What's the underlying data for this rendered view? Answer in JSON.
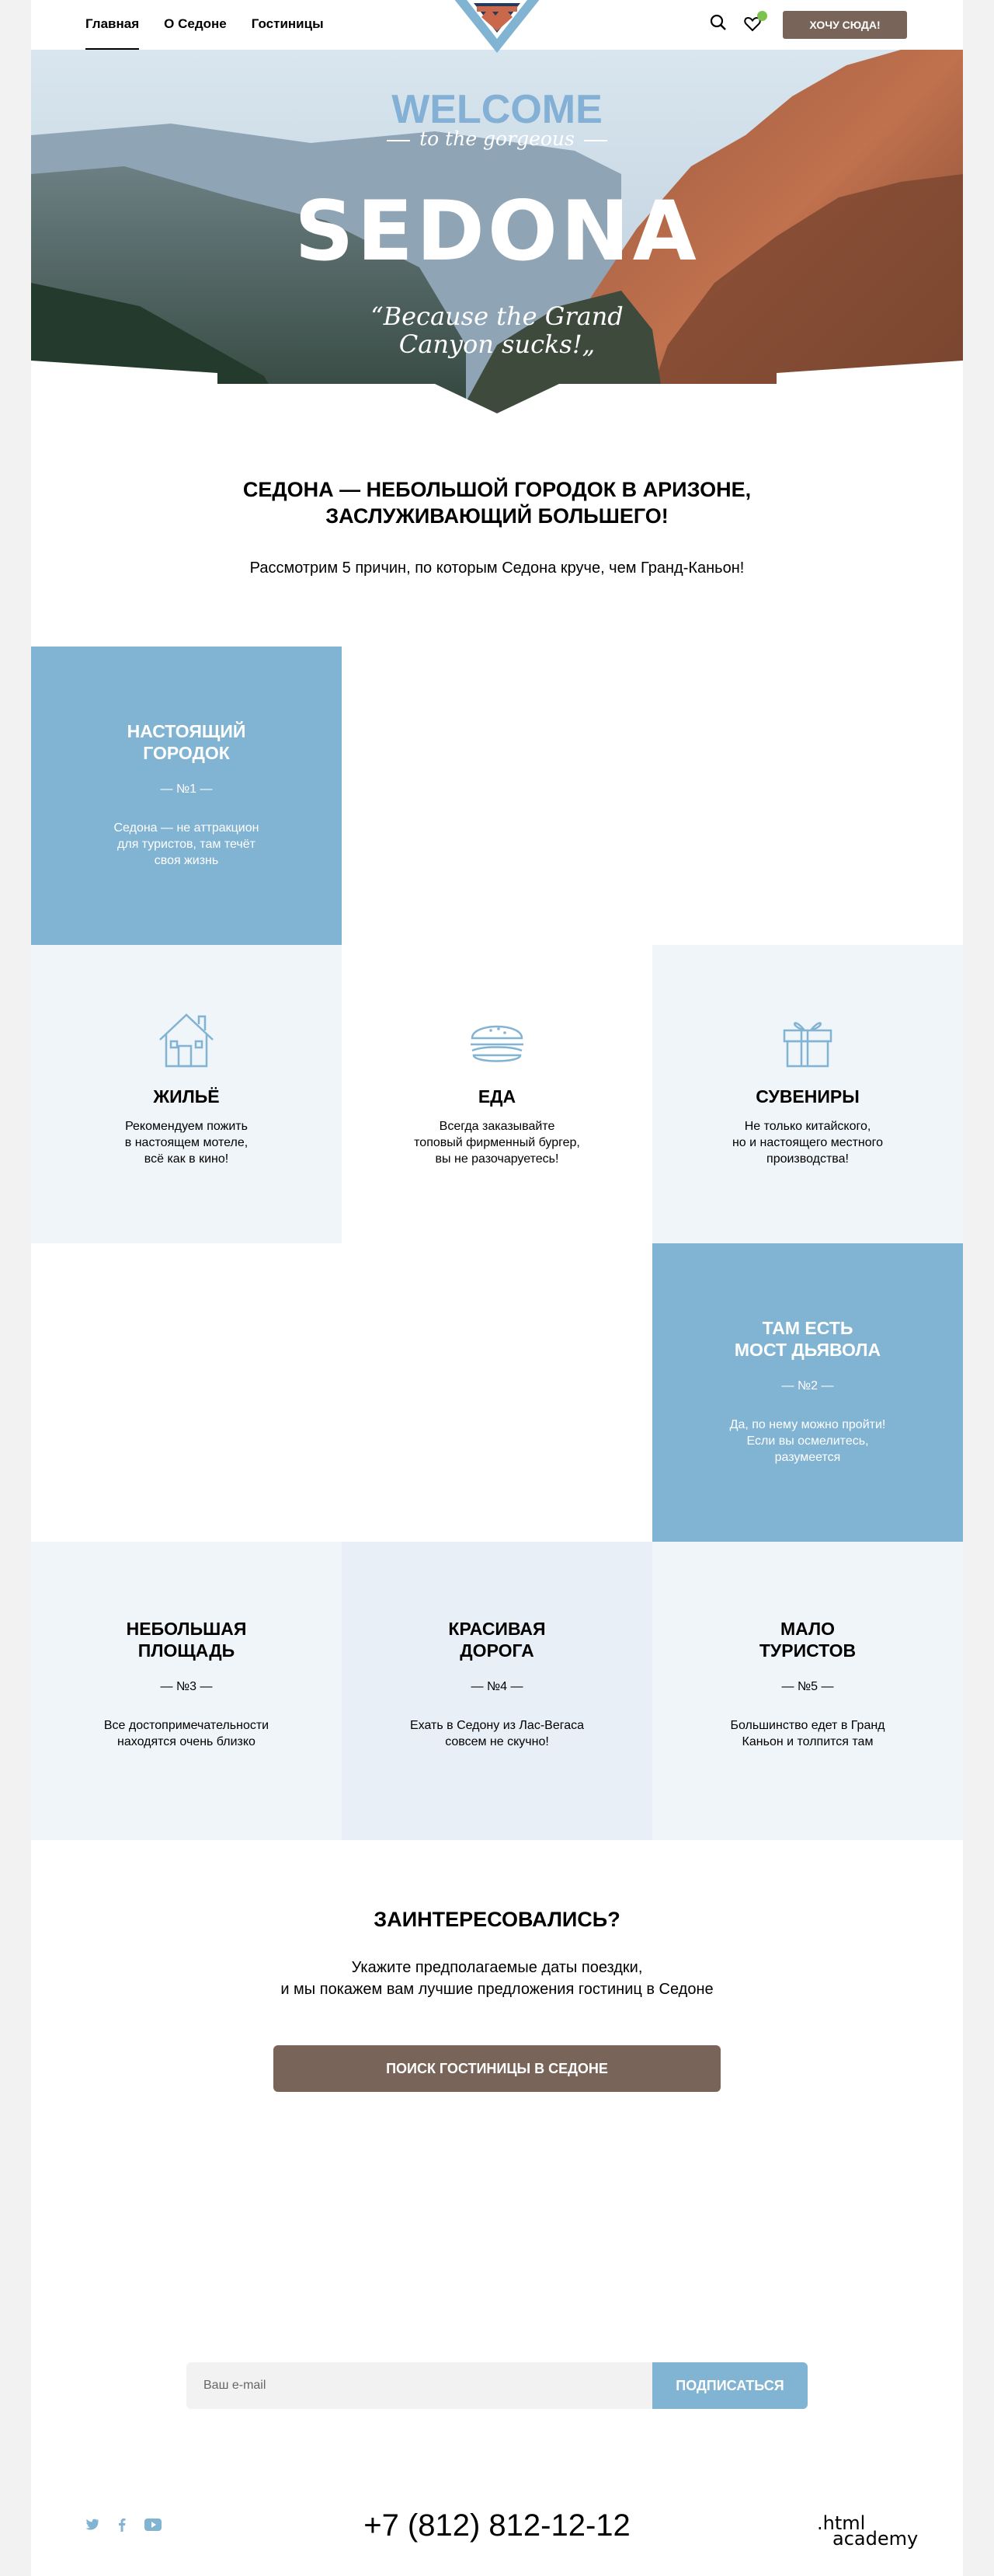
{
  "header": {
    "nav": [
      "Главная",
      "О Седоне",
      "Гостиницы"
    ],
    "cta": "ХОЧУ СЮДА!",
    "icons": {
      "search": "search-icon",
      "favorites": "heart-icon"
    },
    "colors": {
      "accent": "#786458",
      "badge": "#7cc24f"
    }
  },
  "hero": {
    "welcome": "WELCOME",
    "subtitle": "to the gorgeous",
    "title": "SEDONA",
    "quote_line1": "“Because the Grand",
    "quote_line2": "Canyon sucks!„"
  },
  "intro": {
    "title_line1": "СЕДОНА — НЕБОЛЬШОЙ ГОРОДОК В АРИЗОНЕ,",
    "title_line2": "ЗАСЛУЖИВАЮЩИЙ БОЛЬШЕГО!",
    "subtitle": "Рассмотрим 5 причин, по которым Седона круче, чем Гранд-Каньон!"
  },
  "reasons": [
    {
      "title1": "НАСТОЯЩИЙ",
      "title2": "ГОРОДОК",
      "num": "— №1 —",
      "text1": "Седона — не аттракцион",
      "text2": "для туристов, там течёт",
      "text3": "своя жизнь"
    },
    {
      "title1": "ТАМ ЕСТЬ",
      "title2": "МОСТ ДЬЯВОЛА",
      "num": "— №2 —",
      "text1": "Да, по нему можно пройти!",
      "text2": "Если вы осмелитесь,",
      "text3": "разумеется"
    },
    {
      "title1": "НЕБОЛЬШАЯ",
      "title2": "ПЛОЩАДЬ",
      "num": "— №3 —",
      "text1": "Все достопримечательности",
      "text2": "находятся очень близко"
    },
    {
      "title1": "КРАСИВАЯ",
      "title2": "ДОРОГА",
      "num": "— №4 —",
      "text1": "Ехать в Седону из Лас-Вегаса",
      "text2": "совсем не скучно!"
    },
    {
      "title1": "МАЛО",
      "title2": "ТУРИСТОВ",
      "num": "— №5 —",
      "text1": "Большинство едет в Гранд",
      "text2": "Каньон и толпится там"
    }
  ],
  "features": [
    {
      "icon": "house-icon",
      "title": "ЖИЛЬЁ",
      "text1": "Рекомендуем пожить",
      "text2": "в настоящем мотеле,",
      "text3": "всё как в кино!"
    },
    {
      "icon": "burger-icon",
      "title": "ЕДА",
      "text1": "Всегда заказывайте",
      "text2": "топовый фирменный бургер,",
      "text3": "вы не разочаруетесь!"
    },
    {
      "icon": "gift-icon",
      "title": "СУВЕНИРЫ",
      "text1": "Не только китайского,",
      "text2": "но и настоящего местного",
      "text3": "производства!"
    }
  ],
  "interested": {
    "title": "ЗАИНТЕРЕСОВАЛИСЬ?",
    "text1": "Укажите предполагаемые даты поездки,",
    "text2": "и мы покажем вам лучшие предложения гостиниц в Седоне",
    "button": "ПОИСК ГОСТИНИЦЫ В СЕДОНЕ"
  },
  "subscribe": {
    "placeholder": "Ваш e-mail",
    "button": "ПОДПИСАТЬСЯ"
  },
  "footer": {
    "social": [
      "twitter-icon",
      "facebook-icon",
      "youtube-icon"
    ],
    "phone": "+7 (812) 812-12-12",
    "academy1": ".html",
    "academy2": "academy"
  }
}
